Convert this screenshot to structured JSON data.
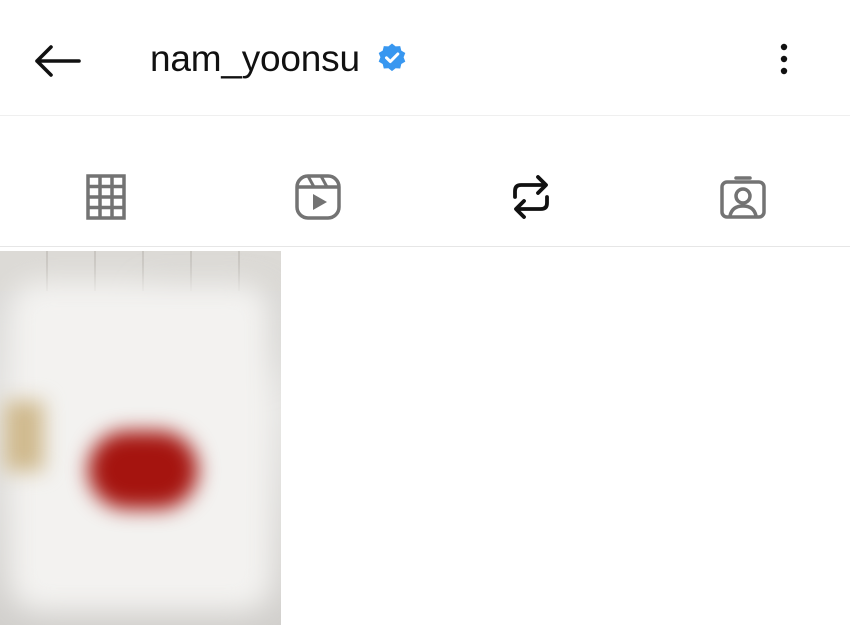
{
  "header": {
    "username": "nam_yoonsu",
    "verified_color": "#3897f0",
    "back_icon": "arrow-left-icon",
    "more_icon": "more-vertical-icon"
  },
  "tabs": [
    {
      "name": "posts",
      "icon": "grid-icon",
      "active": false
    },
    {
      "name": "reels",
      "icon": "reels-icon",
      "active": false
    },
    {
      "name": "reposts",
      "icon": "repost-icon",
      "active": true
    },
    {
      "name": "tagged",
      "icon": "tagged-icon",
      "active": false
    }
  ],
  "grid": {
    "posts": [
      {
        "type": "image",
        "blurred": true
      }
    ]
  },
  "colors": {
    "text": "#111111",
    "icon_inactive": "#737373",
    "divider": "#e6e6e6",
    "active_indicator": "#111111"
  }
}
